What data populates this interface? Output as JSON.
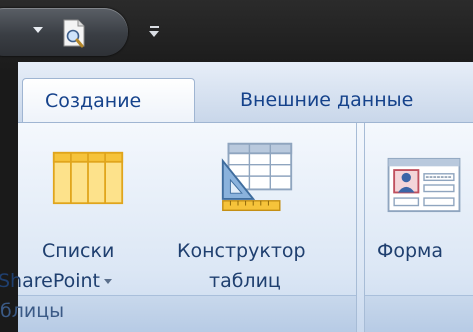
{
  "quick_access": {
    "items": [
      {
        "icon": "dropdown-arrow-icon"
      },
      {
        "icon": "print-preview-icon"
      },
      {
        "icon": "customize-qat-icon"
      }
    ]
  },
  "ribbon": {
    "tabs": [
      {
        "label": "Создание",
        "active": true
      },
      {
        "label": "Внешние данные",
        "active": false
      }
    ],
    "groups": [
      {
        "caption": "блицы",
        "buttons": [
          {
            "label_line1": "Списки",
            "label_line2": "SharePoint",
            "icon": "sharepoint-lists-icon",
            "has_dropdown": true
          },
          {
            "label_line1": "Конструктор",
            "label_line2": "таблиц",
            "icon": "table-design-icon",
            "has_dropdown": false
          }
        ]
      },
      {
        "caption": "",
        "buttons": [
          {
            "label_line1": "Форма",
            "icon": "form-icon"
          }
        ]
      }
    ]
  },
  "colors": {
    "tab_text": "#15428b",
    "label_text": "#1f3f6f",
    "accent_yellow": "#f6c33a"
  }
}
